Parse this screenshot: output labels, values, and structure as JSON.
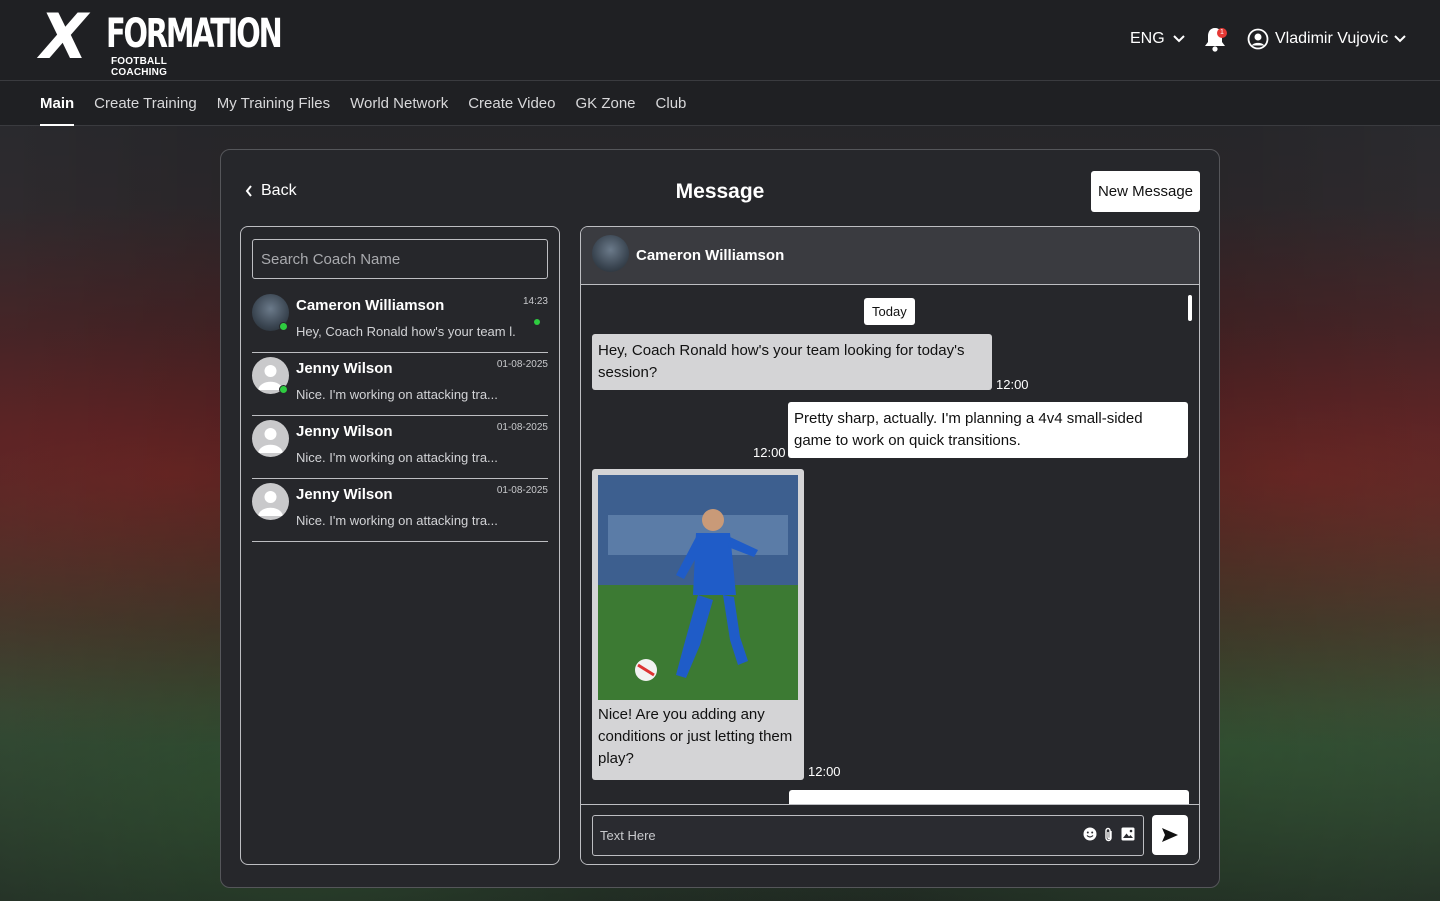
{
  "brand": {
    "logo_x": "X",
    "logo_word": "FORMATION",
    "logo_sub": "FOOTBALL COACHING"
  },
  "header": {
    "language": "ENG",
    "notification_count": "1",
    "user_name": "Vladimir Vujovic"
  },
  "nav": {
    "items": [
      {
        "label": "Main",
        "active": true
      },
      {
        "label": "Create Training",
        "active": false
      },
      {
        "label": "My Training Files",
        "active": false
      },
      {
        "label": "World Network",
        "active": false
      },
      {
        "label": "Create Video",
        "active": false
      },
      {
        "label": "GK Zone",
        "active": false
      },
      {
        "label": "Club",
        "active": false
      }
    ]
  },
  "panel": {
    "back_label": "Back",
    "title": "Message",
    "new_message_label": "New Message"
  },
  "search": {
    "placeholder": "Search Coach Name"
  },
  "conversations": [
    {
      "name": "Cameron Williamson",
      "preview": "Hey, Coach Ronald how's your team l...",
      "time": "14:23",
      "online": true,
      "unread": true
    },
    {
      "name": "Jenny Wilson",
      "preview": "Nice. I'm working on attacking tra...",
      "time": "01-08-2025",
      "online": true,
      "unread": false
    },
    {
      "name": "Jenny Wilson",
      "preview": "Nice. I'm working on attacking tra...",
      "time": "01-08-2025",
      "online": false,
      "unread": false
    },
    {
      "name": "Jenny Wilson",
      "preview": "Nice. I'm working on attacking tra...",
      "time": "01-08-2025",
      "online": false,
      "unread": false
    }
  ],
  "chat": {
    "contact_name": "Cameron Williamson",
    "day_label": "Today",
    "messages": [
      {
        "direction": "in",
        "text": "Hey, Coach Ronald how's your team looking for today's session?",
        "time": "12:00"
      },
      {
        "direction": "out",
        "text": "Pretty sharp, actually. I'm planning a 4v4 small-sided game to work on quick transitions.",
        "time": "12:00"
      },
      {
        "direction": "in",
        "type": "image",
        "text": "Nice! Are you adding any conditions or just letting them play?",
        "time": "12:00"
      }
    ],
    "composer_placeholder": "Text Here"
  },
  "colors": {
    "background": "#1e1f22",
    "panel": "#26272b",
    "incoming_bubble": "#d4d4d6",
    "outgoing_bubble": "#ffffff",
    "online": "#2ecc40",
    "notification": "#e53935"
  }
}
